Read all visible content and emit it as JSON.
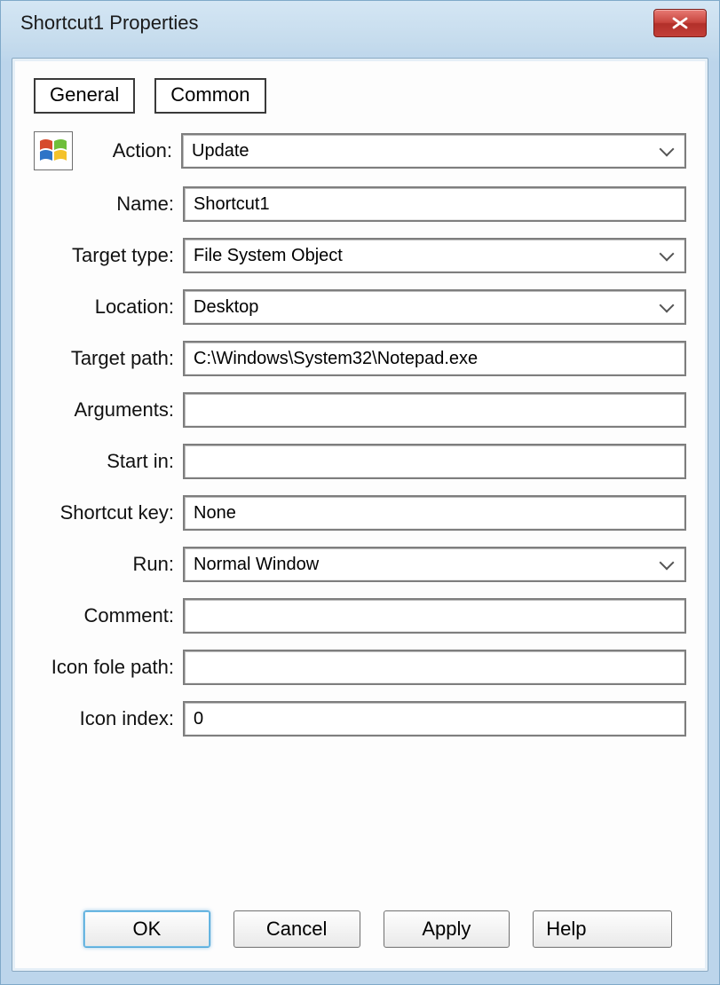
{
  "title": "Shortcut1 Properties",
  "tabs": {
    "general": "General",
    "common": "Common"
  },
  "labels": {
    "action": "Action:",
    "name": "Name:",
    "targetType": "Target type:",
    "location": "Location:",
    "targetPath": "Target path:",
    "arguments": "Arguments:",
    "startIn": "Start in:",
    "shortcutKey": "Shortcut key:",
    "run": "Run:",
    "comment": "Comment:",
    "iconFolePath": "Icon fole path:",
    "iconIndex": "Icon index:"
  },
  "values": {
    "action": "Update",
    "name": "Shortcut1",
    "targetType": "File System Object",
    "location": "Desktop",
    "targetPath": "C:\\Windows\\System32\\Notepad.exe",
    "arguments": "",
    "startIn": "",
    "shortcutKey": "None",
    "run": "Normal Window",
    "comment": "",
    "iconFolePath": "",
    "iconIndex": "0"
  },
  "buttons": {
    "ok": "OK",
    "cancel": "Cancel",
    "apply": "Apply",
    "help": "Help"
  }
}
